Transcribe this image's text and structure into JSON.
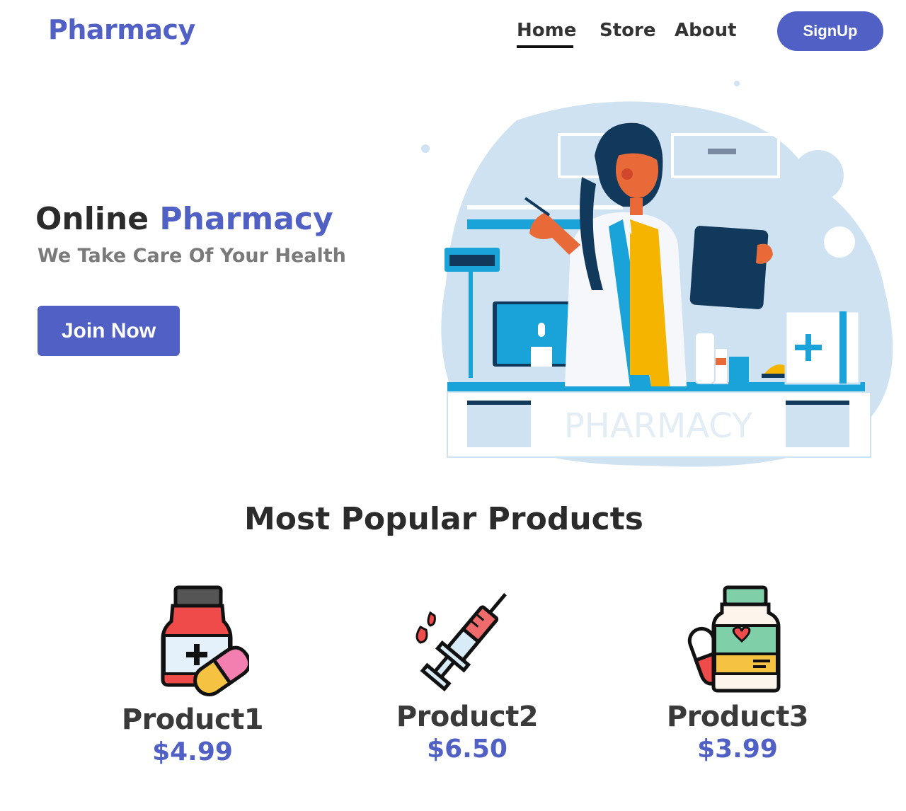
{
  "header": {
    "brand": "Pharmacy",
    "nav": {
      "home": "Home",
      "store": "Store",
      "about": "About"
    },
    "signup": "SignUp"
  },
  "hero": {
    "title_plain": "Online",
    "title_accent": "Pharmacy",
    "subtitle": "We Take Care Of Your Health",
    "cta": "Join Now",
    "illustration_sign": "PHARMACY"
  },
  "products": {
    "title": "Most Popular Products",
    "items": [
      {
        "name": "Product1",
        "price": "$4.99",
        "icon": "medicine-bottle-pill-icon"
      },
      {
        "name": "Product2",
        "price": "$6.50",
        "icon": "syringe-icon"
      },
      {
        "name": "Product3",
        "price": "$3.99",
        "icon": "vitamin-bottle-icon"
      }
    ]
  },
  "colors": {
    "accent": "#5060c4",
    "text": "#333333",
    "muted": "#7a7a7a"
  }
}
